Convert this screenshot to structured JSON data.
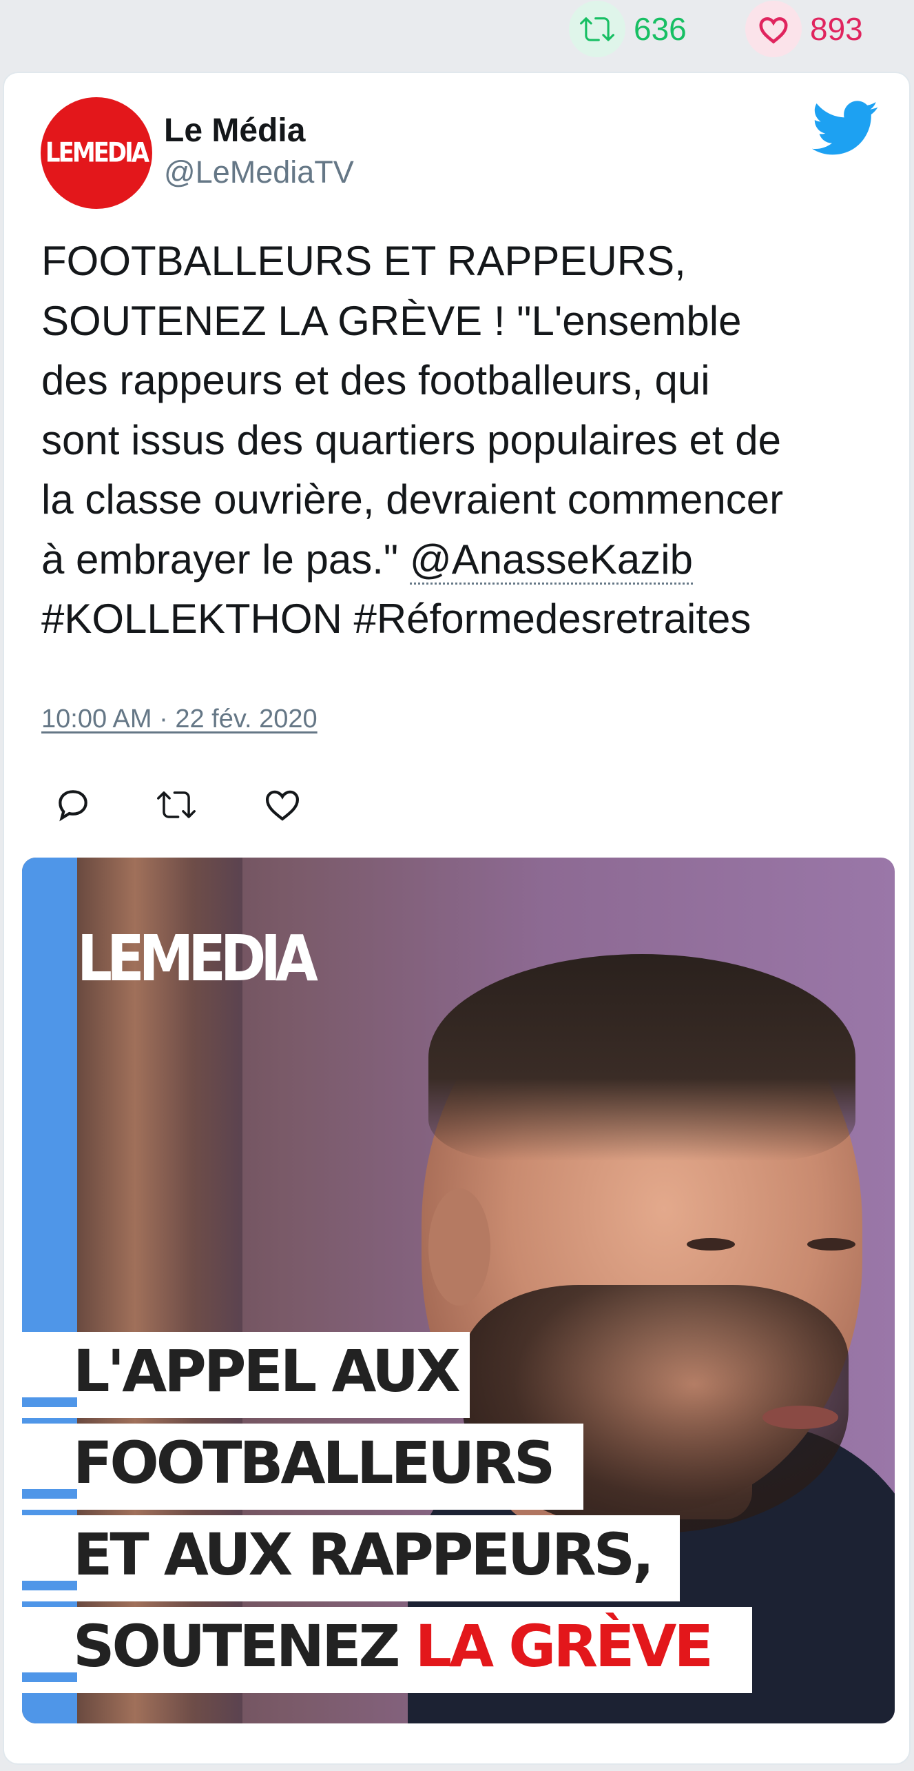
{
  "stats": {
    "retweets": "636",
    "likes": "893"
  },
  "author": {
    "name": "Le Média",
    "handle": "@LeMediaTV",
    "avatar_logo": "LEMEDIA"
  },
  "tweet": {
    "text_lines": [
      "FOOTBALLEURS ET RAPPEURS,",
      "SOUTENEZ LA GRÈVE ! \"L'ensemble",
      "des rappeurs et des footballeurs, qui",
      "sont issus des quartiers populaires et de",
      "la classe ouvrière, devraient commencer"
    ],
    "line6_before_mention": "à embrayer le pas.\" ",
    "mention": "@AnasseKazib",
    "hashtags_line": "#KOLLEKTHON #Réformedesretraites",
    "timestamp": "10:00 AM · 22 fév. 2020"
  },
  "actions": {
    "reply_icon": "reply-icon",
    "retweet_icon": "retweet-icon",
    "like_icon": "heart-icon"
  },
  "media": {
    "logo": "LEMEDIA",
    "caption": {
      "line1": "L'APPEL AUX",
      "line2": "FOOTBALLEURS",
      "line3": "ET AUX RAPPEURS,",
      "line4_black": "SOUTENEZ ",
      "line4_red": "LA GRÈVE"
    }
  },
  "colors": {
    "retweet_green": "#17bf63",
    "like_red": "#e0245e",
    "twitter_blue": "#1da1f2",
    "brand_red": "#e3171b",
    "secondary_text": "#657786"
  }
}
